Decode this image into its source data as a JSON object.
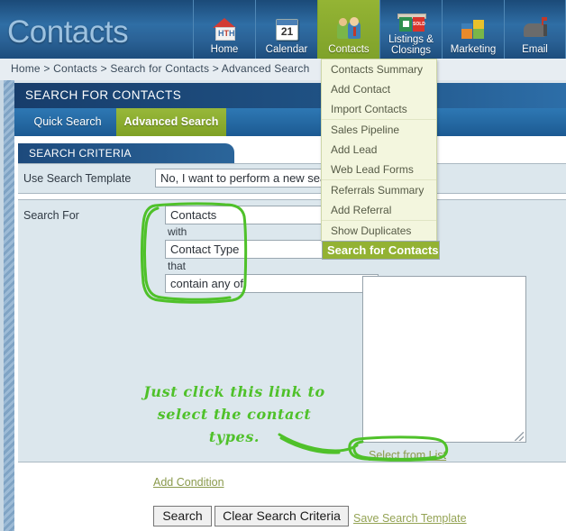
{
  "banner": {
    "title": "Contacts",
    "nav": [
      {
        "label": "Home",
        "icon": "house-icon",
        "active": false
      },
      {
        "label": "Calendar",
        "icon": "calendar-icon",
        "active": false
      },
      {
        "label": "Contacts",
        "icon": "people-icon",
        "active": true
      },
      {
        "label": "Listings & Closings",
        "line1": "Listings &",
        "line2": "Closings",
        "icon": "for-sale-sign-icon",
        "active": false
      },
      {
        "label": "Marketing",
        "icon": "puzzle-icon",
        "active": false
      },
      {
        "label": "Email",
        "icon": "mailbox-icon",
        "active": false
      }
    ],
    "calendar_day": "21",
    "sign_text": "SOLD"
  },
  "dropdown": {
    "items": [
      {
        "label": "Contacts Summary",
        "selected": false,
        "separator": false
      },
      {
        "label": "Add Contact",
        "selected": false,
        "separator": false
      },
      {
        "label": "Import Contacts",
        "selected": false,
        "separator": false
      },
      {
        "label": "Sales Pipeline",
        "selected": false,
        "separator": true
      },
      {
        "label": "Add Lead",
        "selected": false,
        "separator": false
      },
      {
        "label": "Web Lead Forms",
        "selected": false,
        "separator": false
      },
      {
        "label": "Referrals Summary",
        "selected": false,
        "separator": true
      },
      {
        "label": "Add Referral",
        "selected": false,
        "separator": false
      },
      {
        "label": "Show Duplicates",
        "selected": false,
        "separator": true
      },
      {
        "label": "Search for Contacts",
        "selected": true,
        "separator": false
      }
    ]
  },
  "breadcrumb": {
    "text": "Home  >  Contacts  >  Search for Contacts  >  Advanced Search"
  },
  "panel": {
    "header": "SEARCH FOR CONTACTS",
    "tabs": [
      {
        "label": "Quick Search",
        "active": false
      },
      {
        "label": "Advanced Search",
        "active": true
      }
    ]
  },
  "criteria": {
    "header": "SEARCH CRITERIA",
    "template_label": "Use Search Template",
    "template_value": "No, I want to perform a new search",
    "search_for_label": "Search For",
    "what_value": "Contacts",
    "with_label": "with",
    "field_value": "Contact Type",
    "that_label": "that",
    "operator_value": "contain any of",
    "values_textarea": "",
    "select_from_list_link": "Select from List",
    "add_condition_link": "Add Condition",
    "search_button": "Search",
    "clear_button": "Clear Search Criteria",
    "save_template_link": "Save Search Template"
  },
  "annotation": {
    "line1": "Just click this link to",
    "line2": "select the contact",
    "line3": "types.",
    "color": "#4fc12a"
  },
  "colors": {
    "accent_green": "#93b233",
    "banner_blue": "#2f6ea5",
    "panel_bg": "#dce7ed",
    "annotation_green": "#4fc12a",
    "link_olive": "#8a9a4c"
  }
}
